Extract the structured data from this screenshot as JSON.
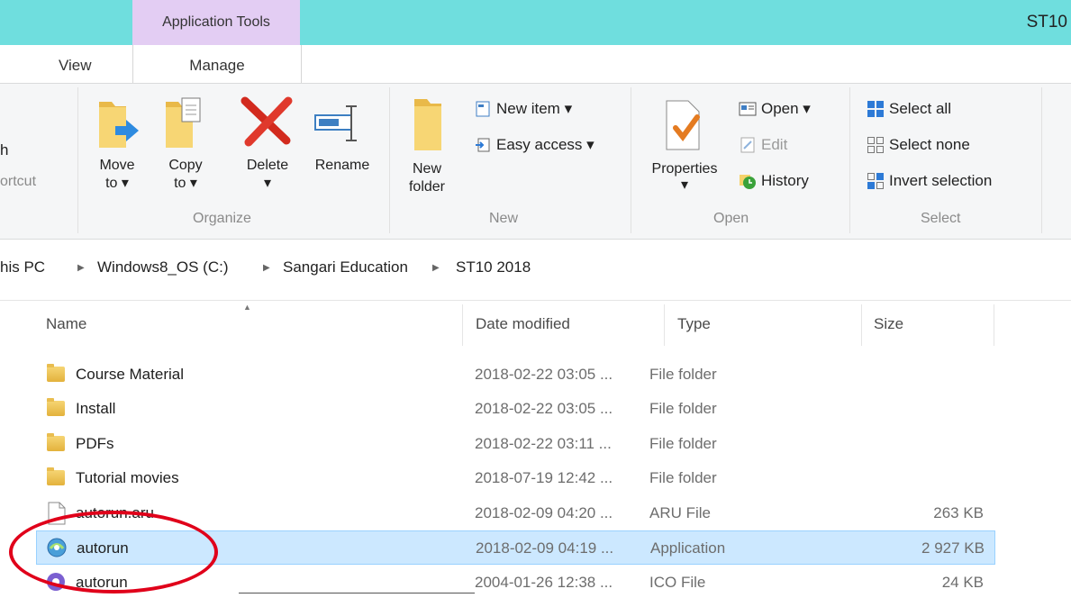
{
  "window": {
    "title": "ST10",
    "context_tab": "Application Tools"
  },
  "tabs": {
    "view": "View",
    "manage": "Manage"
  },
  "ribbon": {
    "clipboard_partial": {
      "top": "h",
      "bottom": "ortcut"
    },
    "organize": {
      "label": "Organize",
      "move_to": [
        "Move",
        "to ▾"
      ],
      "copy_to": [
        "Copy",
        "to ▾"
      ],
      "delete": "Delete",
      "delete_arrow": "▾",
      "rename": "Rename"
    },
    "new": {
      "label": "New",
      "new_folder": [
        "New",
        "folder"
      ],
      "new_item": "New item ▾",
      "easy_access": "Easy access ▾"
    },
    "open": {
      "label": "Open",
      "properties": "Properties",
      "properties_arrow": "▾",
      "open": "Open ▾",
      "edit": "Edit",
      "history": "History"
    },
    "select": {
      "label": "Select",
      "select_all": "Select all",
      "select_none": "Select none",
      "invert_selection": "Invert selection"
    }
  },
  "breadcrumb": {
    "items": [
      "his PC",
      "Windows8_OS (C:)",
      "Sangari Education",
      "ST10 2018"
    ],
    "separator": "▶"
  },
  "columns": {
    "name": "Name",
    "date": "Date modified",
    "type": "Type",
    "size": "Size",
    "sort_arrow": "▲"
  },
  "files": [
    {
      "name": "Course Material",
      "date": "2018-02-22 03:05 ...",
      "type": "File folder",
      "size": "",
      "icon": "folder-icon"
    },
    {
      "name": "Install",
      "date": "2018-02-22 03:05 ...",
      "type": "File folder",
      "size": "",
      "icon": "folder-icon"
    },
    {
      "name": "PDFs",
      "date": "2018-02-22 03:11 ...",
      "type": "File folder",
      "size": "",
      "icon": "folder-icon"
    },
    {
      "name": "Tutorial movies",
      "date": "2018-07-19 12:42 ...",
      "type": "File folder",
      "size": "",
      "icon": "folder-icon"
    },
    {
      "name": "autorun.aru",
      "date": "2018-02-09 04:20 ...",
      "type": "ARU File",
      "size": "263 KB",
      "icon": "file-icon"
    },
    {
      "name": "autorun",
      "date": "2018-02-09 04:19 ...",
      "type": "Application",
      "size": "2 927 KB",
      "icon": "application-icon"
    },
    {
      "name": "autorun",
      "date": "2004-01-26 12:38 ...",
      "type": "ICO File",
      "size": "24 KB",
      "icon": "ico-icon"
    }
  ],
  "colors": {
    "titlebar": "#6fdede",
    "context_tab": "#e3cdf3",
    "selection": "#cce8ff",
    "highlight_circle": "#e0001a"
  }
}
